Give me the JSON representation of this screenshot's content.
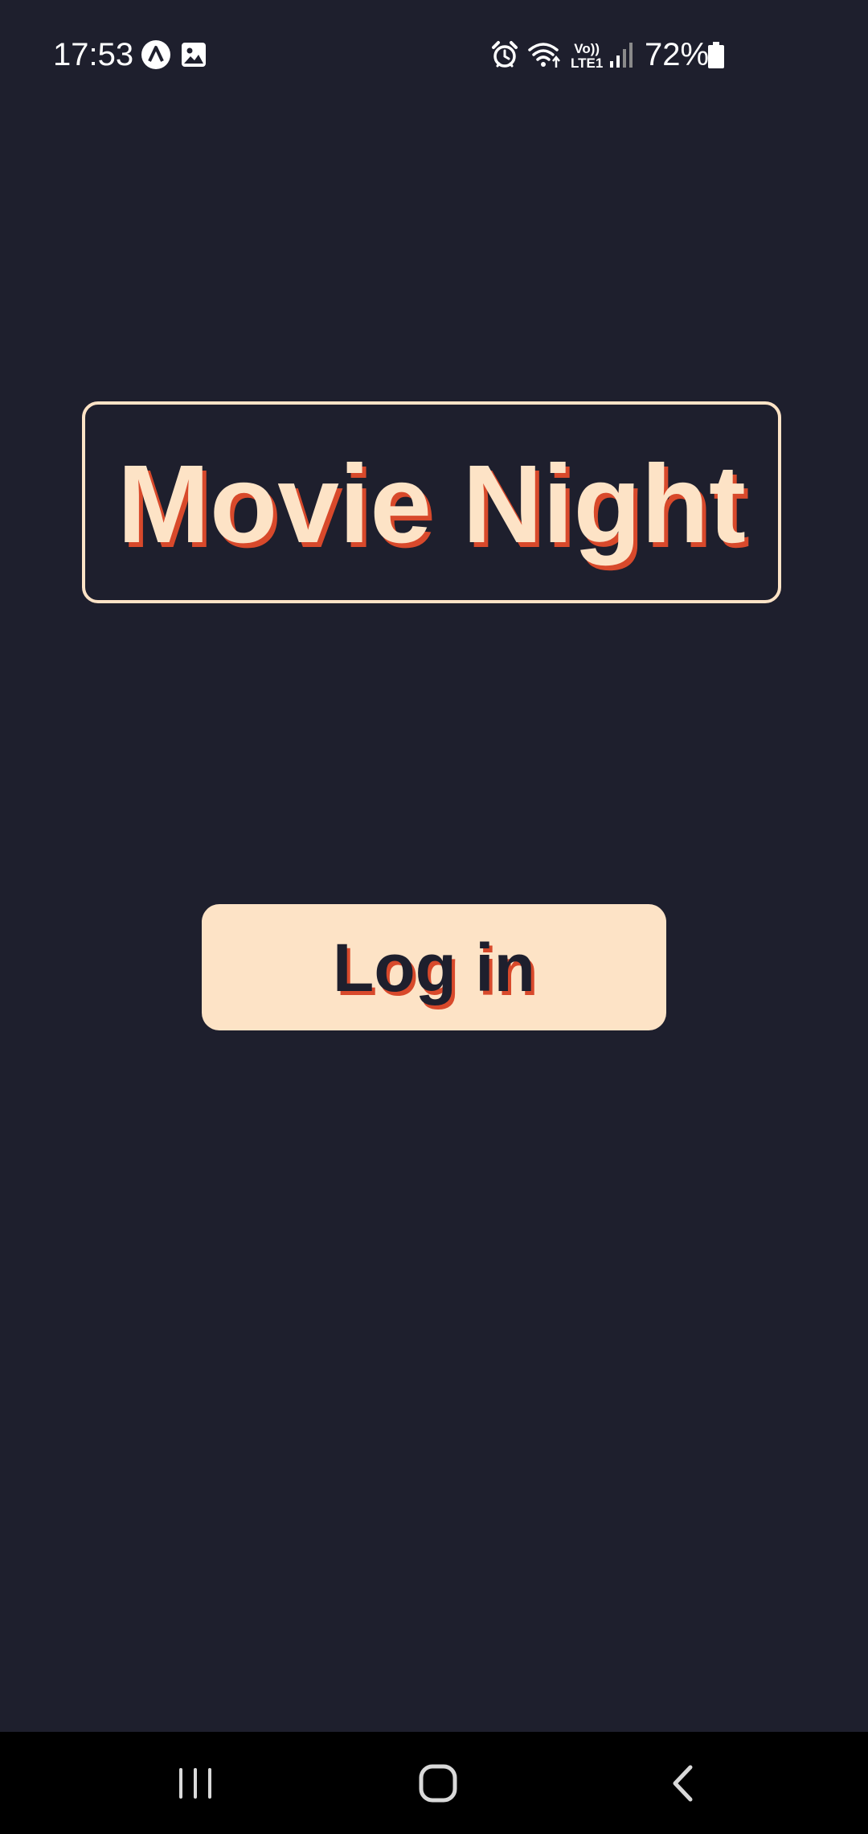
{
  "status_bar": {
    "time": "17:53",
    "network_label_top": "Vo))",
    "network_label_bottom": "LTE1",
    "battery_percent": "72%",
    "icons": [
      "a-letter-icon",
      "image-icon",
      "alarm-icon",
      "wifi-icon",
      "signal-icon",
      "battery-icon"
    ]
  },
  "app": {
    "title": "Movie Night",
    "login_label": "Log in"
  },
  "nav_bar": {
    "icons": [
      "recent-apps-icon",
      "home-icon",
      "back-icon"
    ]
  },
  "colors": {
    "background": "#1e1f2d",
    "accent": "#fde3c6",
    "shadow": "#d8492b",
    "nav_background": "#000000"
  }
}
